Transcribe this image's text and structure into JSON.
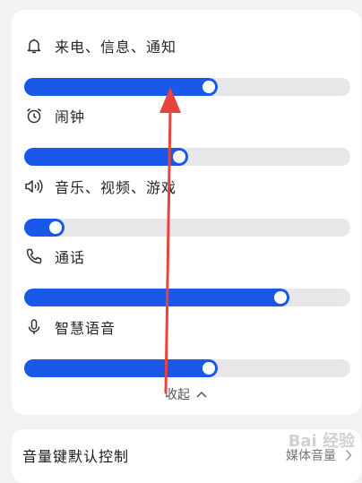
{
  "volume_rows": [
    {
      "label": "来电、信息、通知",
      "icon": "bell-icon",
      "level": 0.565
    },
    {
      "label": "闹钟",
      "icon": "alarm-clock-icon",
      "level": 0.475
    },
    {
      "label": "音乐、视频、游戏",
      "icon": "speaker-icon",
      "level": 0.095
    },
    {
      "label": "通话",
      "icon": "phone-icon",
      "level": 0.785
    },
    {
      "label": "智慧语音",
      "icon": "microphone-icon",
      "level": 0.565
    }
  ],
  "collapse": {
    "label": "收起",
    "icon": "chevron-up-icon"
  },
  "default_control": {
    "title": "音量键默认控制",
    "value": "媒体音量",
    "icon": "chevron-right-icon"
  },
  "colors": {
    "accent": "#1a58ea",
    "track": "#e7e7e9",
    "annotation_arrow": "#e8423f"
  },
  "annotation": {
    "type": "red-arrow",
    "points_to": "来电、信息、通知 slider"
  },
  "watermark": "Bai 经验"
}
